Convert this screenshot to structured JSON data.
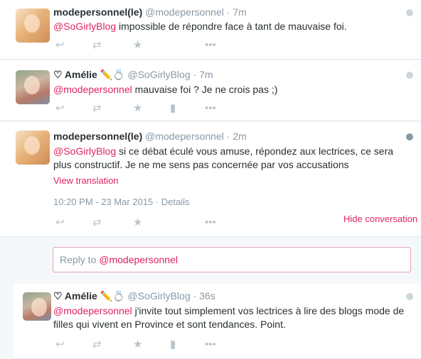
{
  "tweets": [
    {
      "name": "modepersonnel(le)",
      "handle": "@modepersonnel",
      "dot": "·",
      "time": "7m",
      "mention": "@SoGirlyBlog",
      "text": " impossible de répondre face à tant de mauvaise foi."
    },
    {
      "name": "♡ Amélie ✏️💍",
      "handle": "@SoGirlyBlog",
      "dot": "·",
      "time": "7m",
      "mention": "@modepersonnel",
      "text": " mauvaise foi ? Je ne crois pas ;)"
    },
    {
      "name": "modepersonnel(le)",
      "handle": "@modepersonnel",
      "dot": "·",
      "time": "2m",
      "mention": "@SoGirlyBlog",
      "text": " si ce débat éculé vous amuse, répondez aux lectrices, ce sera plus constructif. Je ne me sens pas concernée par vos accusations",
      "translation_label": "View translation",
      "timestamp": "10:20 PM - 23 Mar 2015",
      "details_label": "Details",
      "hide_conversation_label": "Hide conversation"
    },
    {
      "name": "♡ Amélie ✏️💍",
      "handle": "@SoGirlyBlog",
      "dot": "·",
      "time": "36s",
      "mention": "@modepersonnel",
      "text": " j'invite tout simplement vos lectrices à lire des blogs mode de filles qui vivent en Province et sont tendances. Point."
    }
  ],
  "reply_box": {
    "prefix": "Reply to ",
    "mention": "@modepersonnel"
  },
  "icons": {
    "reply": "reply-icon",
    "retweet": "retweet-icon",
    "favorite": "star-icon",
    "analytics": "analytics-icon",
    "more": "more-icon",
    "globe": "globe-icon"
  },
  "colors": {
    "accent": "#e0245e",
    "muted": "#8899a6",
    "icon": "#b8c4cc"
  }
}
